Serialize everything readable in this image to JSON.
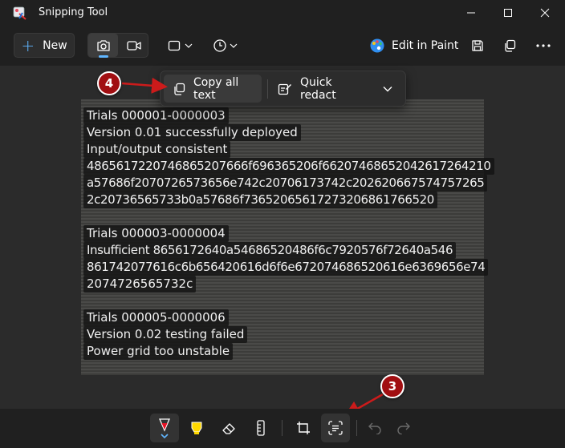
{
  "window": {
    "title": "Snipping Tool",
    "icon": "snipping-tool-app-icon",
    "controls": [
      "minimize-icon",
      "maximize-icon",
      "close-icon"
    ]
  },
  "toolbar": {
    "new_label": "New",
    "modes": [
      "camera-icon",
      "video-icon"
    ],
    "selected_mode": "camera",
    "snip_mode_icon": "rectangle-snip-icon",
    "delay_icon": "clock-icon",
    "edit_in_paint_label": "Edit in Paint",
    "right_icons": [
      "save-icon",
      "copy-icon",
      "more-icon"
    ]
  },
  "text_actions": {
    "copy_all_label": "Copy all text",
    "quick_redact_label": "Quick redact"
  },
  "ocr_lines": [
    "Trials 000001-0000003",
    "Version 0.01 successfully deployed",
    "Input/output consistent",
    "4865617220746865207666f696365206f66207468652042617264210",
    "a57686f2070726573656e742c20706173742c202620667574757265",
    "2c20736565733b0a57686f73652065617273206861766520",
    "Trials 000003-0000004",
    "Insufficient 8656172640a54686520486f6c7920576f72640a546",
    "861742077616c6b656420616d6f6e672074686520616e6369656e74",
    "2074726565732c",
    "Trials 000005-0000006",
    "Version 0.02 testing failed",
    "Power grid too unstable"
  ],
  "annotations": {
    "step_3": "3",
    "step_4": "4",
    "accent_color": "#a10f12"
  },
  "bottom_tools": [
    "ballpoint-pen-icon",
    "highlighter-icon",
    "eraser-icon",
    "ruler-icon",
    "crop-icon",
    "text-actions-icon",
    "undo-icon",
    "redo-icon"
  ],
  "colors": {
    "accent_blue": "#60b6ff",
    "pen_red": "#e81123",
    "highlighter_yellow": "#ffd800"
  }
}
